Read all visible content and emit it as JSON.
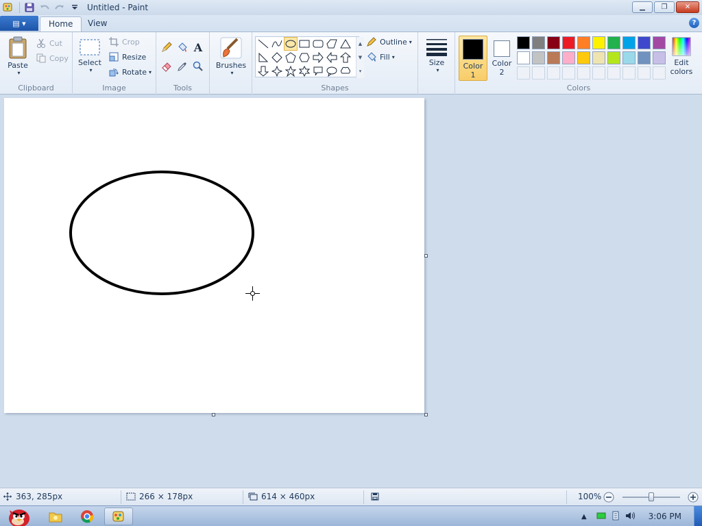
{
  "window": {
    "title": "Untitled - Paint"
  },
  "tabs": [
    {
      "label": "Home",
      "active": true
    },
    {
      "label": "View",
      "active": false
    }
  ],
  "ribbon": {
    "clipboard": {
      "label": "Clipboard",
      "paste": "Paste",
      "cut": "Cut",
      "copy": "Copy"
    },
    "image": {
      "label": "Image",
      "select": "Select",
      "crop": "Crop",
      "resize": "Resize",
      "rotate": "Rotate"
    },
    "tools": {
      "label": "Tools"
    },
    "brushes": {
      "label": "Brushes"
    },
    "shapes": {
      "label": "Shapes",
      "outline": "Outline",
      "fill": "Fill"
    },
    "size": {
      "label": "Size"
    },
    "colors": {
      "label": "Colors",
      "color1_line1": "Color",
      "color1_line2": "1",
      "color2_line1": "Color",
      "color2_line2": "2",
      "edit_line1": "Edit",
      "edit_line2": "colors",
      "color1": "#000000",
      "color2": "#ffffff",
      "palette_row1": [
        "#000000",
        "#7f7f7f",
        "#880015",
        "#ed1c24",
        "#ff7f27",
        "#fff200",
        "#22b14c",
        "#00a2e8",
        "#3f48cc",
        "#a349a4"
      ],
      "palette_row2": [
        "#ffffff",
        "#c3c3c3",
        "#b97a57",
        "#ffaec9",
        "#ffc90e",
        "#efe4b0",
        "#b5e61d",
        "#99d9ea",
        "#7092be",
        "#c8bfe7"
      ]
    }
  },
  "canvas": {
    "shape_stroke": "#000000"
  },
  "status": {
    "cursor_pos": "363, 285px",
    "selection_size": "266 × 178px",
    "image_size": "614 × 460px",
    "zoom": "100%"
  },
  "taskbar": {
    "time": "3:06 PM"
  }
}
